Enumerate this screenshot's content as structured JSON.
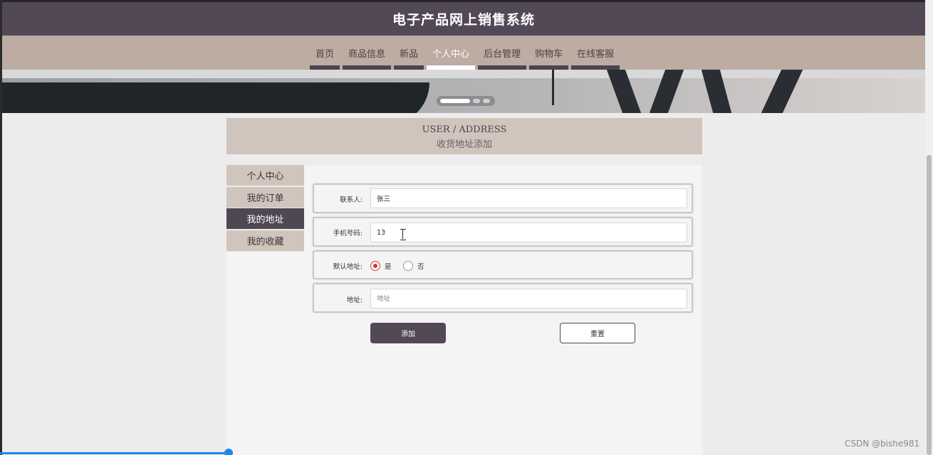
{
  "site": {
    "title": "电子产品网上销售系统"
  },
  "nav": {
    "items": [
      {
        "label": "首页"
      },
      {
        "label": "商品信息"
      },
      {
        "label": "新品"
      },
      {
        "label": "个人中心"
      },
      {
        "label": "后台管理"
      },
      {
        "label": "购物车"
      },
      {
        "label": "在线客服"
      }
    ],
    "active": "个人中心"
  },
  "section": {
    "title_en": "USER / ADDRESS",
    "title_cn": "收货地址添加"
  },
  "sidebar": {
    "items": [
      {
        "label": "个人中心"
      },
      {
        "label": "我的订单"
      },
      {
        "label": "我的地址"
      },
      {
        "label": "我的收藏"
      }
    ],
    "active": "我的地址"
  },
  "form": {
    "contact": {
      "label": "联系人:",
      "value": "张三"
    },
    "phone": {
      "label": "手机号码:",
      "value": "13"
    },
    "default": {
      "label": "默认地址:",
      "options": [
        "是",
        "否"
      ],
      "selected": "是"
    },
    "address": {
      "label": "地址:",
      "placeholder": "地址",
      "value": ""
    },
    "submit_label": "添加",
    "reset_label": "重置"
  },
  "watermark": "CSDN @bishe981",
  "colors": {
    "header": "#524856",
    "nav": "#bcaca2",
    "accent": "#c93a3a"
  }
}
